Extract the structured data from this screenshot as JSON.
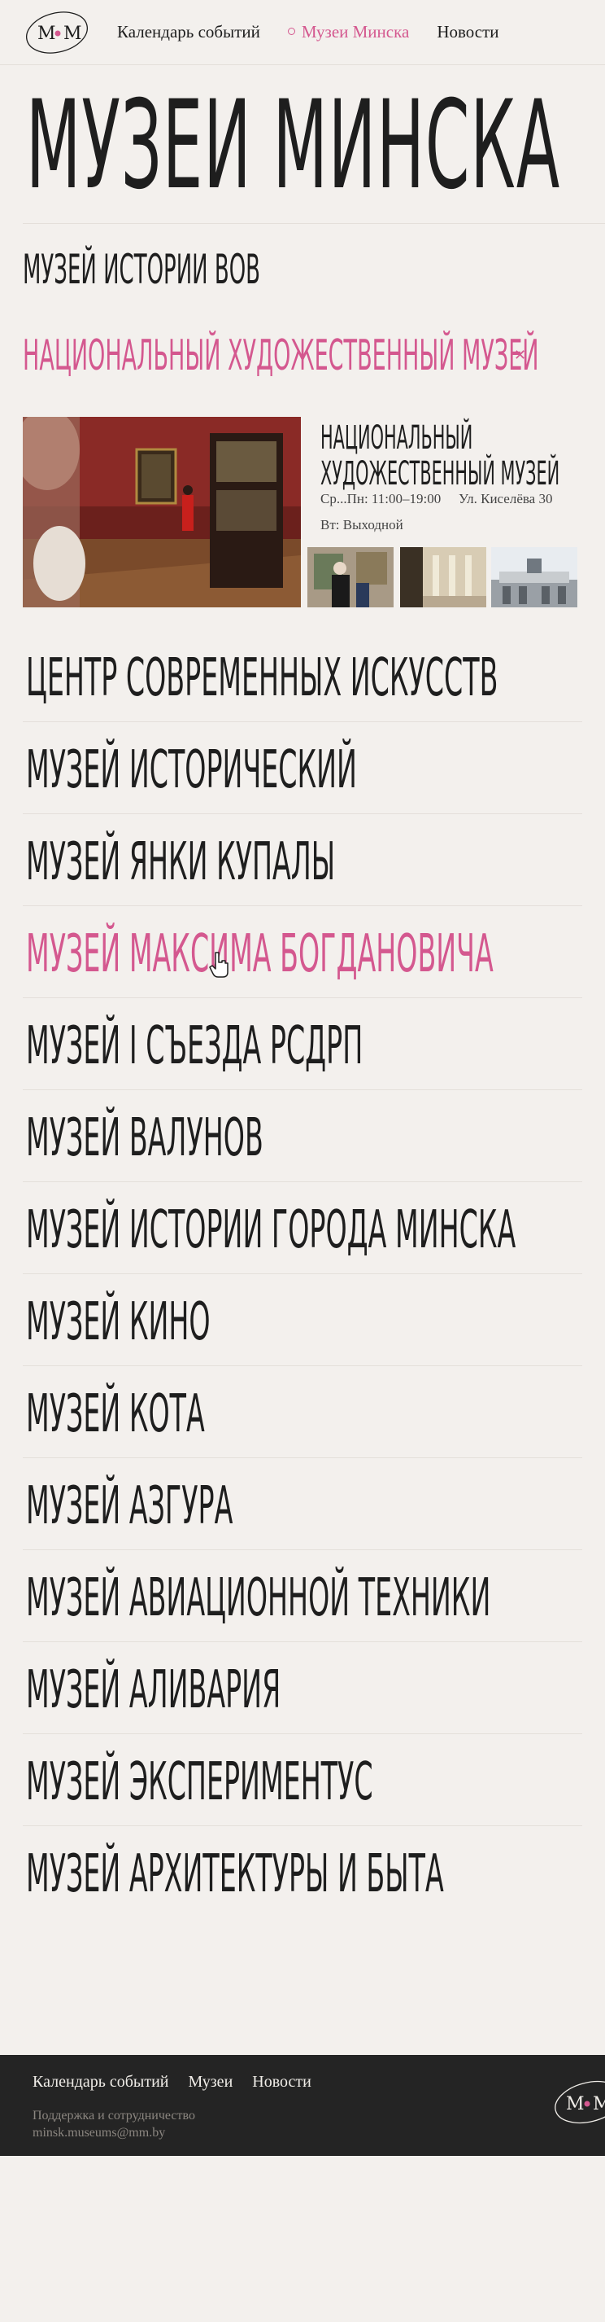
{
  "header": {
    "logo_letters": "M M",
    "nav": [
      {
        "label": "Календарь событий"
      },
      {
        "label": "Музеи Минска",
        "active": true
      },
      {
        "label": "Новости"
      }
    ]
  },
  "page_title": "Музеи Минска",
  "museums_top": [
    {
      "name": "Музей истории ВОВ"
    },
    {
      "name": "Национальный художественный музей",
      "expanded": true
    }
  ],
  "expanded": {
    "name": "Национальный художественный музей",
    "hours": "Ср...Пн: 11:00–19:00",
    "address": "Ул. Киселёва 30",
    "day_off": "Вт: Выходной"
  },
  "museums": [
    {
      "name": "Центр современных искусств"
    },
    {
      "name": "Музей исторический"
    },
    {
      "name": "Музей Янки Купалы"
    },
    {
      "name": "Музей Максима Богдановича",
      "hover": true
    },
    {
      "name": "Музей I съезда РСДРП"
    },
    {
      "name": "Музей валунов"
    },
    {
      "name": "Музей истории города Минска"
    },
    {
      "name": "Музей кино"
    },
    {
      "name": "Музей кота"
    },
    {
      "name": "Музей Азгура"
    },
    {
      "name": "Музей авиационной техники"
    },
    {
      "name": "Музей Аливария"
    },
    {
      "name": "Музей Экспериментус"
    },
    {
      "name": "Музей архитектуры и быта"
    }
  ],
  "footer": {
    "nav": [
      {
        "label": "Календарь событий"
      },
      {
        "label": "Музеи"
      },
      {
        "label": "Новости"
      }
    ],
    "support_label": "Поддержка и сотрудничество",
    "email": "minsk.museums@mm.by"
  },
  "colors": {
    "background": "#f3f0ed",
    "accent": "#d4588f",
    "text": "#1e1e1e",
    "footer_bg": "#242424"
  },
  "icons": [
    "logo-icon",
    "close-icon",
    "pointer-cursor-icon"
  ]
}
